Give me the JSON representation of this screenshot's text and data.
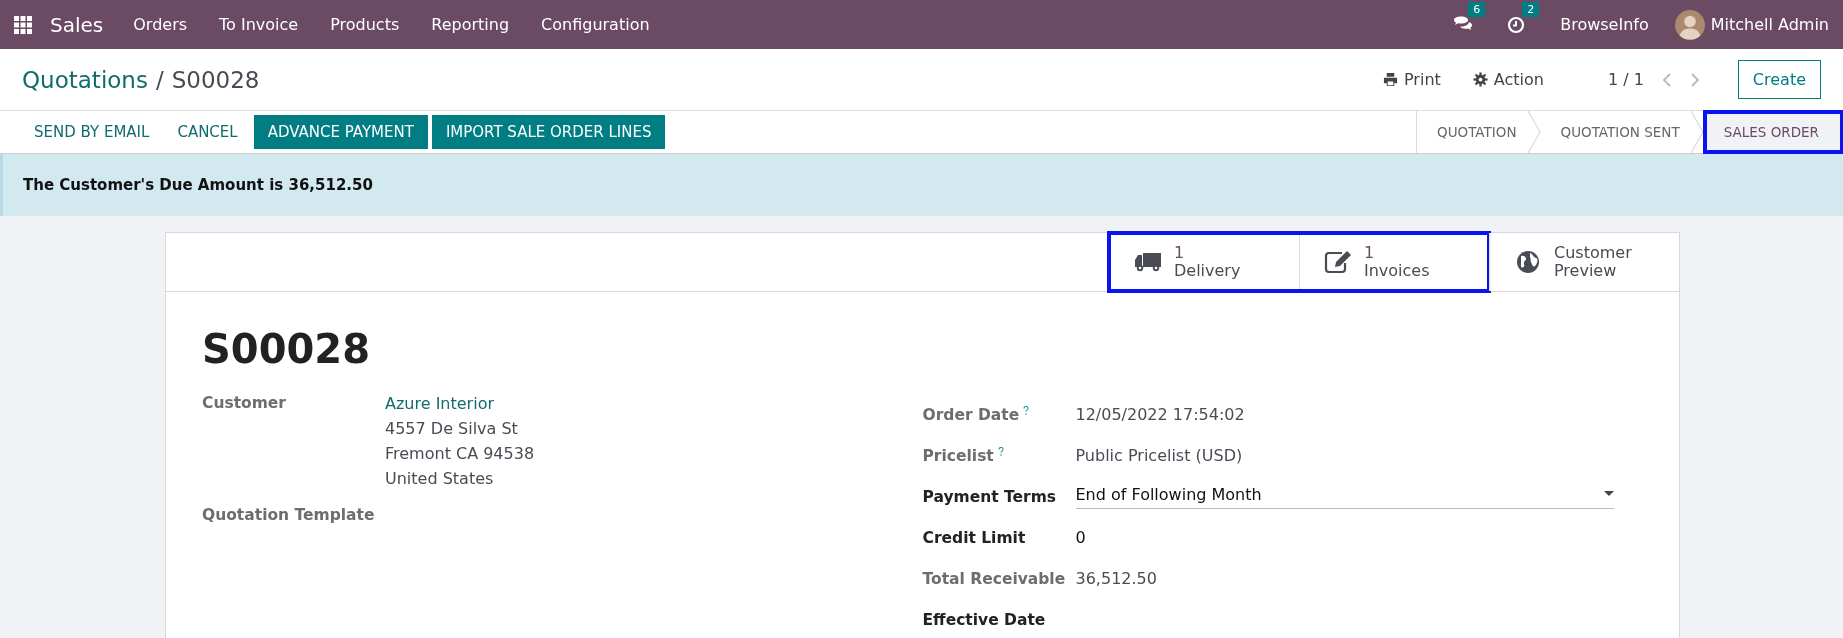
{
  "navbar": {
    "app": "Sales",
    "menu": [
      "Orders",
      "To Invoice",
      "Products",
      "Reporting",
      "Configuration"
    ],
    "messages_count": "6",
    "activities_count": "2",
    "company": "BrowseInfo",
    "user": "Mitchell Admin"
  },
  "breadcrumb": {
    "parent": "Quotations",
    "separator": "/",
    "current": "S00028"
  },
  "actions": {
    "print": "Print",
    "action": "Action",
    "pager": "1 / 1",
    "create": "Create"
  },
  "buttons": [
    {
      "label": "SEND BY EMAIL",
      "kind": "link"
    },
    {
      "label": "CANCEL",
      "kind": "link"
    },
    {
      "label": "ADVANCE PAYMENT",
      "kind": "primary"
    },
    {
      "label": "IMPORT SALE ORDER LINES",
      "kind": "primary"
    }
  ],
  "stages": [
    {
      "label": "QUOTATION",
      "selected": false,
      "highlighted": false
    },
    {
      "label": "QUOTATION SENT",
      "selected": false,
      "highlighted": false
    },
    {
      "label": "SALES ORDER",
      "selected": true,
      "highlighted": true
    }
  ],
  "alert": "The Customer's Due Amount is 36,512.50",
  "smart_buttons": [
    {
      "kind": "truck",
      "count": "1",
      "label": "Delivery",
      "highlighted": true
    },
    {
      "kind": "edit",
      "count": "1",
      "label": "Invoices",
      "highlighted": true
    },
    {
      "kind": "globe",
      "label": "Customer Preview",
      "highlighted": false
    }
  ],
  "title": "S00028",
  "left_fields": [
    {
      "label": "Customer",
      "link": "Azure Interior",
      "lines": [
        "4557 De Silva St",
        "Fremont CA 94538",
        "United States"
      ]
    },
    {
      "label": "Quotation Template"
    }
  ],
  "right_fields": [
    {
      "label": "Order Date",
      "help": true,
      "readonly": true,
      "kind": "text",
      "value": "12/05/2022 17:54:02"
    },
    {
      "label": "Pricelist",
      "help": true,
      "readonly": true,
      "kind": "text",
      "value": "Public Pricelist (USD)"
    },
    {
      "label": "Payment Terms",
      "help": false,
      "readonly": false,
      "kind": "select",
      "value": "End of Following Month"
    },
    {
      "label": "Credit Limit",
      "help": false,
      "readonly": false,
      "kind": "text",
      "value": "0"
    },
    {
      "label": "Total Receivable",
      "help": false,
      "readonly": true,
      "kind": "text",
      "value": "36,512.50"
    },
    {
      "label": "Effective Date",
      "help": false,
      "readonly": false,
      "kind": "text"
    }
  ]
}
